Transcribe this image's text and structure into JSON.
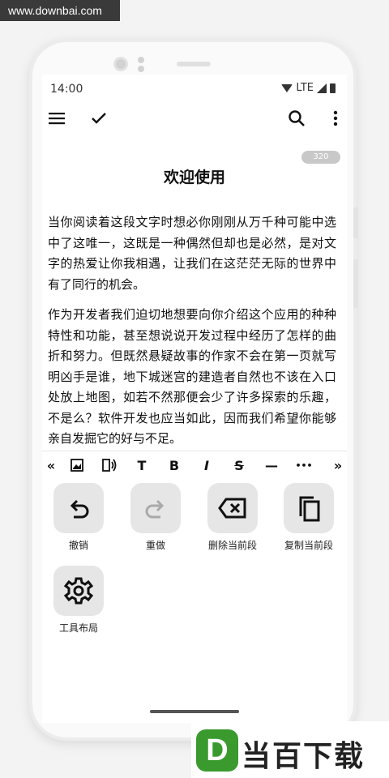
{
  "watermark_top": "www.downbai.com",
  "status_bar": {
    "time": "14:00",
    "network": "LTE"
  },
  "toolbar": {
    "menu_icon": "menu-icon",
    "confirm_icon": "check-icon",
    "search_icon": "search-icon",
    "more_icon": "more-vert-icon"
  },
  "document": {
    "char_count": "320",
    "title": "欢迎使用",
    "paragraphs": [
      "当你阅读着这段文字时想必你刚刚从万千种可能中选中了这唯一，这既是一种偶然但却也是必然，是对文字的热爱让你我相遇，让我们在这茫茫无际的世界中有了同行的机会。",
      "作为开发者我们迫切地想要向你介绍这个应用的种种特性和功能，甚至想说说开发过程中经历了怎样的曲折和努力。但既然悬疑故事的作家不会在第一页就写明凶手是谁，地下城迷宫的建造者自然也不该在入口处放上地图，如若不然那便会少了许多探索的乐趣，不是么？软件开发也应当如此，因而我们希望你能够亲自发掘它的好与不足。"
    ]
  },
  "format_bar": {
    "collapse": "«",
    "text": "T",
    "bold": "B",
    "italic": "I",
    "strike": "S",
    "rule": "—",
    "more": "•••",
    "expand": "»"
  },
  "tools": [
    {
      "label": "撤销",
      "icon": "undo-icon"
    },
    {
      "label": "重做",
      "icon": "redo-icon"
    },
    {
      "label": "删除当前段",
      "icon": "backspace-icon"
    },
    {
      "label": "复制当前段",
      "icon": "copy-icon"
    },
    {
      "label": "工具布局",
      "icon": "gear-icon"
    }
  ],
  "watermark_logo": {
    "letter": "D",
    "text": "当百下载"
  },
  "colors": {
    "accent_green": "#3a9a2e",
    "tool_bg": "#e6e6e6",
    "counter_bg": "#c8c8c8"
  }
}
